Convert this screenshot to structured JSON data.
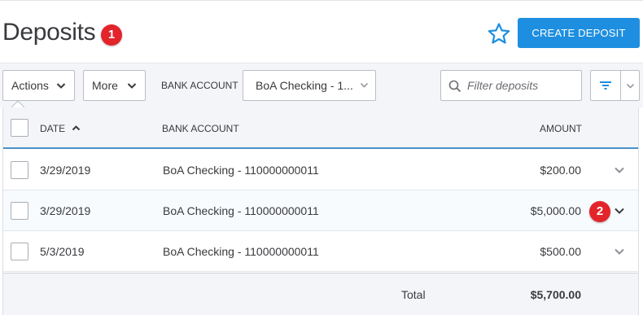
{
  "header": {
    "title": "Deposits",
    "badge_1": "1",
    "star_icon": "star-outline-icon",
    "create_button": "CREATE DEPOSIT"
  },
  "toolbar": {
    "actions_label": "Actions",
    "more_label": "More",
    "bank_account_label": "BANK ACCOUNT",
    "bank_account_value": "BoA Checking - 1...",
    "search_placeholder": "Filter deposits",
    "filter_icon": "filter-icon"
  },
  "table": {
    "columns": {
      "date": "DATE",
      "bank_account": "BANK ACCOUNT",
      "amount": "AMOUNT"
    },
    "sort": "ascending",
    "rows": [
      {
        "date": "3/29/2019",
        "bank_account": "BoA Checking - 110000000011",
        "amount": "$200.00"
      },
      {
        "date": "3/29/2019",
        "bank_account": "BoA Checking - 110000000011",
        "amount": "$5,000.00"
      },
      {
        "date": "5/3/2019",
        "bank_account": "BoA Checking - 110000000011",
        "amount": "$500.00"
      }
    ],
    "total_label": "Total",
    "total_amount": "$5,700.00",
    "badge_2": "2"
  },
  "colors": {
    "primary_button": "#1e8fe0",
    "badge": "#e3242b",
    "accent_line": "#4a90c9",
    "star": "#1e8fe0"
  }
}
